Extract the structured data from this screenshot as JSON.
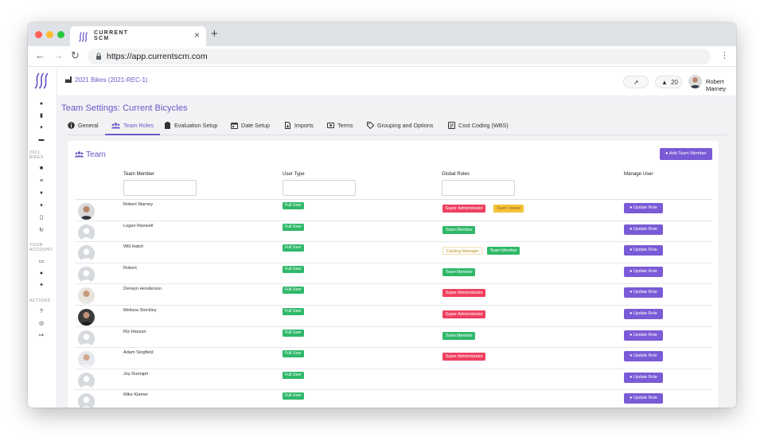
{
  "browser": {
    "tab_title_line1": "CURRENT",
    "tab_title_line2": "SCM",
    "url": "https://app.currentscm.com"
  },
  "header": {
    "project": "2021 Bikes (2021-REC-1)",
    "notifications": "20",
    "user": "Robert Marney"
  },
  "sidebar": {
    "section_project_line1": "2021",
    "section_project_line2": "BIKES",
    "section_account_line1": "YOUR",
    "section_account_line2": "ACCOUNT",
    "section_actions": "ACTIONS"
  },
  "page": {
    "title": "Team Settings: Current Bicycles",
    "tabs": [
      {
        "label": "General"
      },
      {
        "label": "Team Roles"
      },
      {
        "label": "Evaluation Setup"
      },
      {
        "label": "Date Setup"
      },
      {
        "label": "Imports"
      },
      {
        "label": "Terms"
      },
      {
        "label": "Grouping and Options"
      },
      {
        "label": "Cost Coding (WBS)"
      }
    ]
  },
  "team": {
    "title": "Team",
    "add_button": "Add Team Member",
    "columns": [
      "Team Member",
      "User Type",
      "Global Roles",
      "Manage User"
    ],
    "update_label": "Update Role",
    "rows": [
      {
        "name": "Robert Marney",
        "type": "Full User",
        "roles": [
          "Super Administrator",
          "Team Viewer"
        ]
      },
      {
        "name": "Logan Maxwell",
        "type": "Full User",
        "roles": [
          "Team Member"
        ]
      },
      {
        "name": "Will Hatch",
        "type": "Full User",
        "roles": [
          "Catalog Manager",
          "Team Member"
        ]
      },
      {
        "name": "Robert",
        "type": "Full User",
        "roles": [
          "Team Member"
        ]
      },
      {
        "name": "Derwyn Henderson",
        "type": "Full User",
        "roles": [
          "Super Administrator"
        ]
      },
      {
        "name": "Melissa Stockley",
        "type": "Full User",
        "roles": [
          "Super Administrator"
        ]
      },
      {
        "name": "Riz Hassan",
        "type": "Full User",
        "roles": [
          "Team Member"
        ]
      },
      {
        "name": "Adam Singfield",
        "type": "Full User",
        "roles": [
          "Super Administrator"
        ]
      },
      {
        "name": "Joy Dumapit",
        "type": "Full User",
        "roles": []
      },
      {
        "name": "Mike Klamer",
        "type": "Full User",
        "roles": []
      }
    ]
  },
  "colors": {
    "accent": "#6b58c8",
    "button": "#7a5ad6",
    "success": "#2fb86a",
    "danger": "#ef4060",
    "warning": "#f5c23b"
  }
}
